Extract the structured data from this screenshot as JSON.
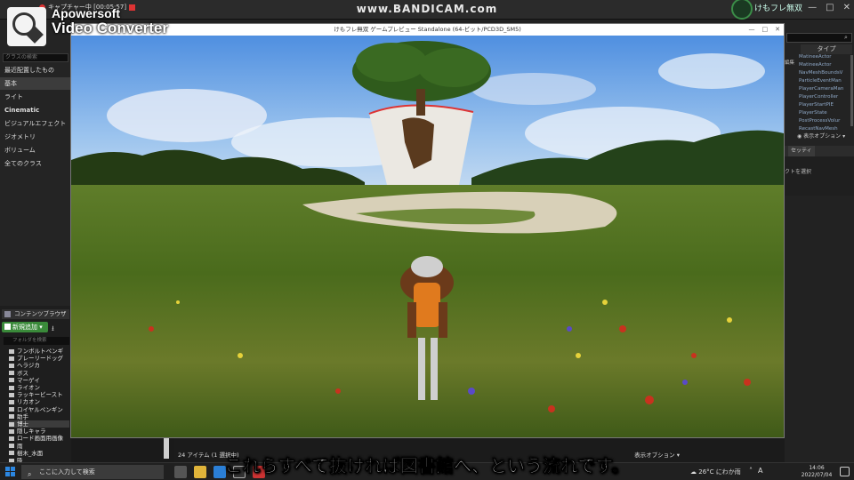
{
  "top_bar": {
    "capture_label": "キャプチャー中 [00:05:57]",
    "bandicam": "www.BANDICAM.com",
    "game_title": "けもフレ無双"
  },
  "watermark": {
    "line1": "Apowersoft",
    "line2": "Video Converter"
  },
  "left_panel": {
    "search_placeholder": "クラスの検索",
    "items": [
      {
        "label": "最近配置したもの"
      },
      {
        "label": "基本"
      },
      {
        "label": "ライト"
      },
      {
        "label": "Cinematic"
      },
      {
        "label": "ビジュアルエフェクト"
      },
      {
        "label": "ジオメトリ"
      },
      {
        "label": "ボリューム"
      },
      {
        "label": "全てのクラス"
      }
    ]
  },
  "outliner": {
    "type_header": "タイプ",
    "edit_label": "編集",
    "rows": [
      "MatineeActor",
      "MatineeActor",
      "NavMeshBoundsV",
      "ParticleEventMan",
      "PlayerCameraMan",
      "PlayerController",
      "PlayerStartPIE",
      "PlayerState",
      "PostProcessVolur",
      "RecastNavMesh"
    ],
    "view_options": "表示オプション ▾"
  },
  "details": {
    "tab_label": "セッティ",
    "hint": "クトを選択"
  },
  "game_window": {
    "title": "けもフレ無双 ゲームプレビュー Standalone (64-ビット/PCD3D_SM5)",
    "min": "—",
    "max": "□",
    "close": "✕"
  },
  "content_browser": {
    "tab_label": "コンテンツブラウザ",
    "add_new": "新規追加 ▾",
    "import_icon": "⭳",
    "folder_search_placeholder": "フォルダを検索",
    "folders": [
      {
        "label": "フンボルトペンギ"
      },
      {
        "label": "プレーリードッグ"
      },
      {
        "label": "ヘラジカ"
      },
      {
        "label": "ボス"
      },
      {
        "label": "マーゲイ"
      },
      {
        "label": "ライオン"
      },
      {
        "label": "ラッキービースト"
      },
      {
        "label": "リカオン"
      },
      {
        "label": "ロイヤルペンギン"
      },
      {
        "label": "助手"
      },
      {
        "label": "博士"
      },
      {
        "label": "隠しキャラ"
      },
      {
        "label": "ロード画面用画像"
      },
      {
        "label": "雨"
      },
      {
        "label": "樹木_水面"
      },
      {
        "label": "吸"
      }
    ],
    "item_count": "24 アイテム (1 選択中)",
    "view_options": "表示オプション ▾"
  },
  "subtitle": "これらすべて抜ければ図書館へ、という流れです。",
  "taskbar": {
    "search_placeholder": "ここに入力して検索",
    "weather": "26°C にわか雨",
    "ime": "A",
    "time": "14:06",
    "date": "2022/07/04"
  }
}
